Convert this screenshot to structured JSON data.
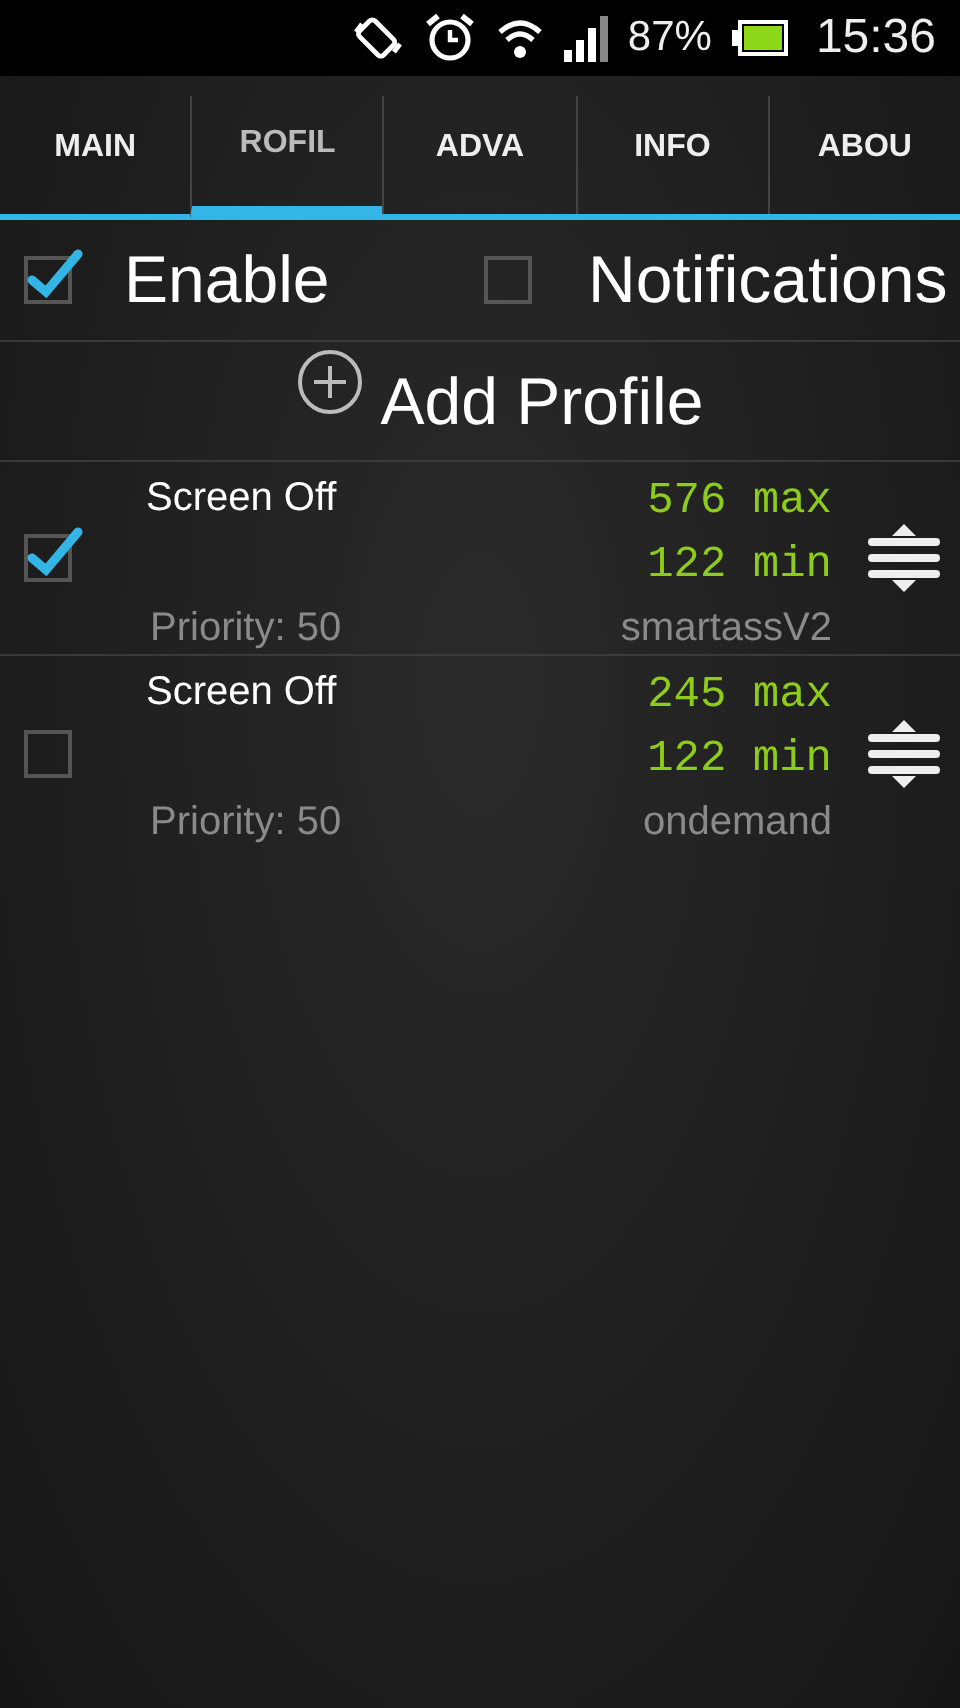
{
  "status_bar": {
    "battery": "87%",
    "time": "15:36"
  },
  "tabs": [
    {
      "label": "MAIN",
      "selected": false
    },
    {
      "label": "ROFIL",
      "selected": true
    },
    {
      "label": "ADVA",
      "selected": false
    },
    {
      "label": "INFO",
      "selected": false
    },
    {
      "label": "ABOU",
      "selected": false
    }
  ],
  "options": [
    {
      "label": "Enable",
      "checked": true
    },
    {
      "label": "Notifications",
      "checked": false
    }
  ],
  "add_button": {
    "label": "Add Profile"
  },
  "profiles": [
    {
      "name": "Screen Off",
      "max": "576 max",
      "min": "122 min",
      "priority": "Priority: 50",
      "governor": "smartassV2",
      "checked": true
    },
    {
      "name": "Screen Off",
      "max": "245 max",
      "min": "122 min",
      "priority": "Priority: 50",
      "governor": "ondemand",
      "checked": false
    }
  ]
}
